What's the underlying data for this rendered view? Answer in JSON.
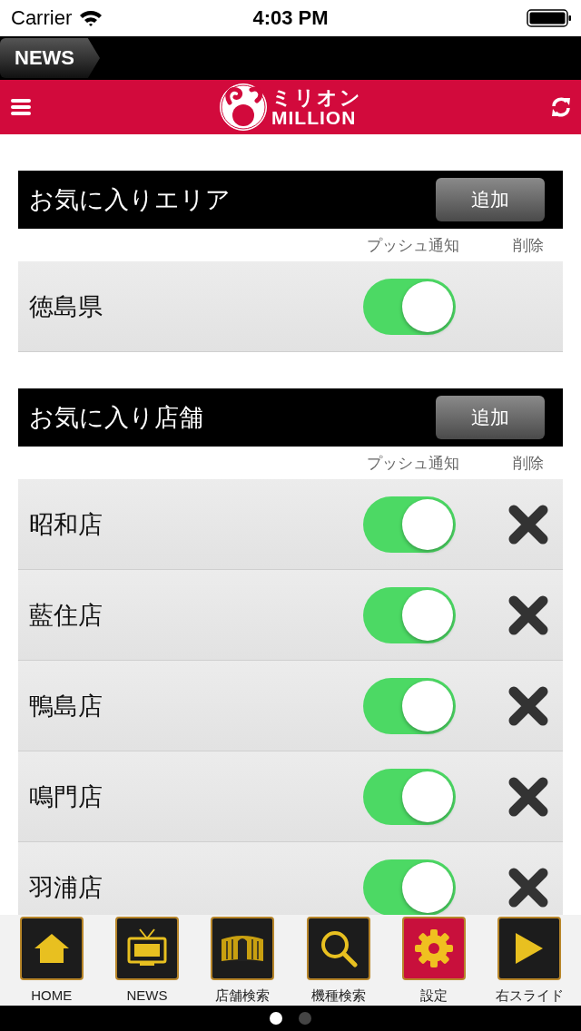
{
  "status_bar": {
    "carrier": "Carrier",
    "time": "4:03 PM"
  },
  "news_tab": {
    "label": "NEWS"
  },
  "header": {
    "logo_kana": "ミリオン",
    "logo_latin": "MILLION"
  },
  "sections": [
    {
      "title": "お気に入りエリア",
      "add_button": "追加",
      "columns": [
        "プッシュ通知",
        "削除"
      ],
      "rows": [
        {
          "name": "徳島県",
          "on": true,
          "deletable": false
        }
      ]
    },
    {
      "title": "お気に入り店舗",
      "add_button": "追加",
      "columns": [
        "プッシュ通知",
        "削除"
      ],
      "rows": [
        {
          "name": "昭和店",
          "on": true,
          "deletable": true
        },
        {
          "name": "藍住店",
          "on": true,
          "deletable": true
        },
        {
          "name": "鴨島店",
          "on": true,
          "deletable": true
        },
        {
          "name": "鳴門店",
          "on": true,
          "deletable": true
        },
        {
          "name": "羽浦店",
          "on": true,
          "deletable": true
        }
      ]
    }
  ],
  "tab_bar": [
    {
      "label": "HOME",
      "kind": "home",
      "selected": false
    },
    {
      "label": "NEWS",
      "kind": "tv",
      "selected": false
    },
    {
      "label": "店舗検索",
      "kind": "store",
      "selected": false
    },
    {
      "label": "機種検索",
      "kind": "search",
      "selected": false
    },
    {
      "label": "設定",
      "kind": "settings",
      "selected": true
    },
    {
      "label": "右スライド",
      "kind": "next",
      "selected": false
    }
  ],
  "page_dots": [
    {
      "selected": true
    },
    {
      "selected": false
    }
  ]
}
